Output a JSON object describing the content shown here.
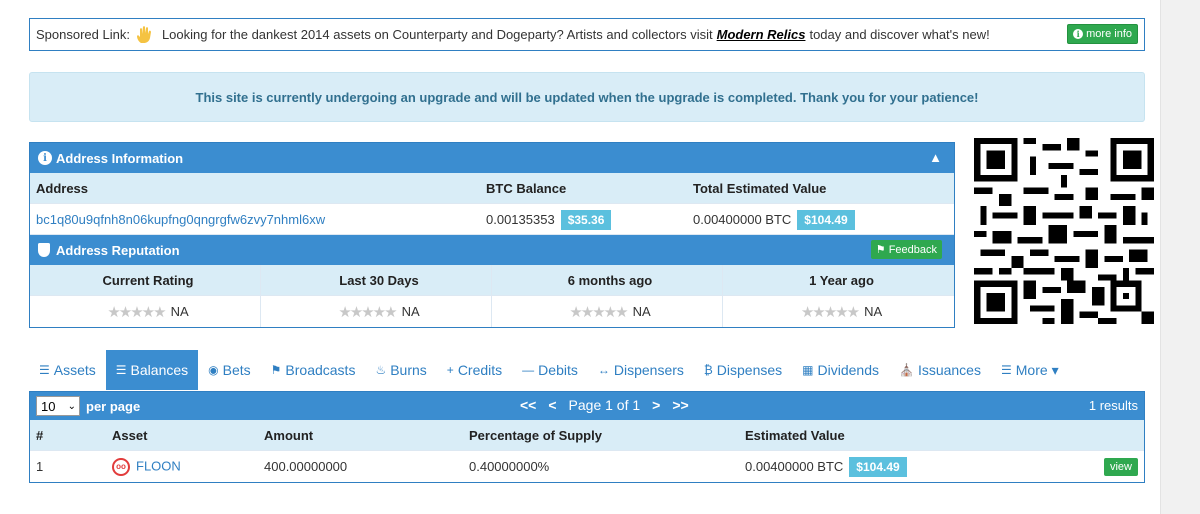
{
  "sponsor": {
    "label": "Sponsored Link:",
    "text_before": "Looking for the dankest 2014 assets on Counterparty and Dogeparty? Artists and collectors visit",
    "link": "Modern Relics",
    "text_after": "today and discover what's new!",
    "more_info": "more info"
  },
  "notice": "This site is currently undergoing an upgrade and will be updated when the upgrade is completed. Thank you for your patience!",
  "address_info": {
    "title": "Address Information",
    "headers": {
      "address": "Address",
      "btc_balance": "BTC Balance",
      "total_value": "Total Estimated Value"
    },
    "address": "bc1q80u9qfnh8n06kupfng0qngrgfw6zvy7nhml6xw",
    "btc_balance": "0.00135353",
    "btc_usd": "$35.36",
    "total_btc": "0.00400000 BTC",
    "total_usd": "$104.49"
  },
  "reputation": {
    "title": "Address Reputation",
    "feedback": "Feedback",
    "headers": [
      "Current Rating",
      "Last 30 Days",
      "6 months ago",
      "1 Year ago"
    ],
    "values": [
      "NA",
      "NA",
      "NA",
      "NA"
    ]
  },
  "tabs": [
    "Assets",
    "Balances",
    "Bets",
    "Broadcasts",
    "Burns",
    "Credits",
    "Debits",
    "Dispensers",
    "Dispenses",
    "Dividends",
    "Issuances",
    "More"
  ],
  "active_tab": "Balances",
  "table": {
    "page_size": "10",
    "per_page": "per page",
    "page_label": "Page 1 of 1",
    "results": "1 results",
    "headers": [
      "#",
      "Asset",
      "Amount",
      "Percentage of Supply",
      "Estimated Value"
    ],
    "rows": [
      {
        "num": "1",
        "asset": "FLOON",
        "amount": "400.00000000",
        "pct": "0.40000000%",
        "value_btc": "0.00400000 BTC",
        "value_usd": "$104.49",
        "action": "view"
      }
    ]
  },
  "colors": {
    "primary": "#3b8dd0",
    "info_bg": "#d9edf7",
    "success": "#2fa84f",
    "badge": "#5bc0de"
  }
}
